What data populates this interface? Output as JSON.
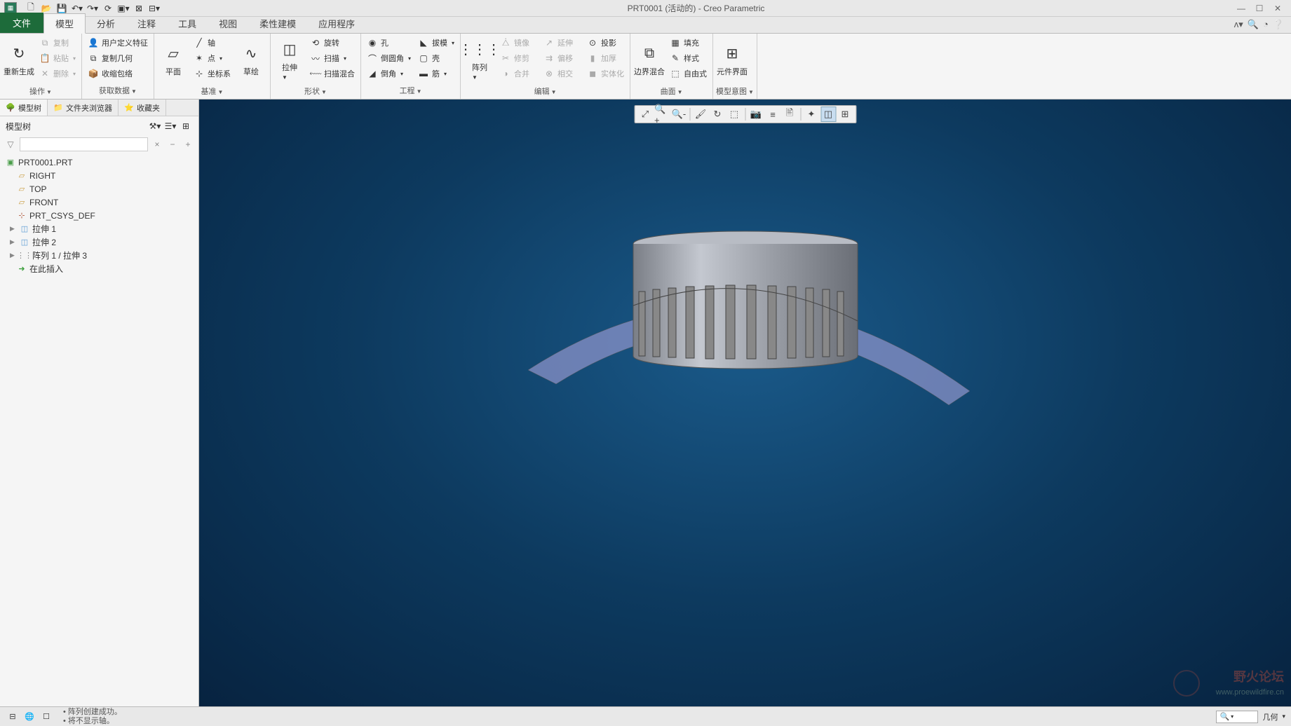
{
  "window": {
    "title": "PRT0001 (活动的) - Creo Parametric"
  },
  "qat": {
    "items": [
      "new",
      "open",
      "save",
      "undo",
      "redo",
      "regen",
      "windows",
      "close",
      "more"
    ]
  },
  "tabs": {
    "file": "文件",
    "list": [
      "模型",
      "分析",
      "注释",
      "工具",
      "视图",
      "柔性建模",
      "应用程序"
    ],
    "active": 0
  },
  "ribbon": {
    "groups": [
      {
        "label": "操作",
        "items": [
          {
            "big": "重新生成",
            "icon": "↻"
          },
          {
            "col": [
              {
                "t": "复制",
                "i": "⧉",
                "d": true
              },
              {
                "t": "粘贴",
                "i": "📋",
                "d": true,
                "dd": true
              },
              {
                "t": "删除",
                "i": "✕",
                "d": true,
                "dd": true
              }
            ]
          }
        ]
      },
      {
        "label": "获取数据",
        "items": [
          {
            "col": [
              {
                "t": "用户定义特征",
                "i": "👤"
              },
              {
                "t": "复制几何",
                "i": "⧉"
              },
              {
                "t": "收缩包络",
                "i": "📦"
              }
            ]
          }
        ]
      },
      {
        "label": "基准",
        "items": [
          {
            "big": "平面",
            "icon": "▱"
          },
          {
            "col": [
              {
                "t": "轴",
                "i": "╱"
              },
              {
                "t": "点",
                "i": "✶",
                "dd": true
              },
              {
                "t": "坐标系",
                "i": "⊹"
              }
            ]
          },
          {
            "big": "草绘",
            "icon": "∿"
          }
        ]
      },
      {
        "label": "形状",
        "items": [
          {
            "big": "拉伸",
            "icon": "◫",
            "dd": true
          },
          {
            "col": [
              {
                "t": "旋转",
                "i": "⟲"
              },
              {
                "t": "扫描",
                "i": "〰",
                "dd": true
              },
              {
                "t": "扫描混合",
                "i": "⬳"
              }
            ]
          }
        ]
      },
      {
        "label": "工程",
        "items": [
          {
            "col": [
              {
                "t": "孔",
                "i": "◉"
              },
              {
                "t": "倒圆角",
                "i": "⌒",
                "dd": true
              },
              {
                "t": "倒角",
                "i": "◢",
                "dd": true
              }
            ]
          },
          {
            "col": [
              {
                "t": "拔模",
                "i": "◣",
                "dd": true
              },
              {
                "t": "壳",
                "i": "▢"
              },
              {
                "t": "筋",
                "i": "▬",
                "dd": true
              }
            ]
          }
        ]
      },
      {
        "label": "编辑",
        "items": [
          {
            "big": "阵列",
            "icon": "⋮⋮⋮",
            "dd": true
          },
          {
            "col": [
              {
                "t": "镜像",
                "i": "⧊",
                "d": true
              },
              {
                "t": "修剪",
                "i": "✂",
                "d": true
              },
              {
                "t": "合并",
                "i": "◑",
                "d": true
              }
            ]
          },
          {
            "col": [
              {
                "t": "延伸",
                "i": "↗",
                "d": true
              },
              {
                "t": "偏移",
                "i": "⇉",
                "d": true
              },
              {
                "t": "相交",
                "i": "⊗",
                "d": true
              }
            ]
          },
          {
            "col": [
              {
                "t": "投影",
                "i": "⊙"
              },
              {
                "t": "加厚",
                "i": "▮",
                "d": true
              },
              {
                "t": "实体化",
                "i": "◼",
                "d": true
              }
            ]
          }
        ]
      },
      {
        "label": "曲面",
        "items": [
          {
            "big": "边界混合",
            "icon": "⧉"
          },
          {
            "col": [
              {
                "t": "填充",
                "i": "▦"
              },
              {
                "t": "样式",
                "i": "✎"
              },
              {
                "t": "自由式",
                "i": "⬚"
              }
            ]
          }
        ]
      },
      {
        "label": "模型意图",
        "items": [
          {
            "big": "元件界面",
            "icon": "⊞"
          }
        ]
      }
    ]
  },
  "sidepanel": {
    "tabs": [
      "模型树",
      "文件夹浏览器",
      "收藏夹"
    ],
    "tree_label": "模型树",
    "root": "PRT0001.PRT",
    "items": [
      {
        "t": "RIGHT",
        "cls": "datum",
        "i": "▱"
      },
      {
        "t": "TOP",
        "cls": "datum",
        "i": "▱"
      },
      {
        "t": "FRONT",
        "cls": "datum",
        "i": "▱"
      },
      {
        "t": "PRT_CSYS_DEF",
        "cls": "csys",
        "i": "⊹"
      },
      {
        "t": "拉伸 1",
        "cls": "feat",
        "i": "◫",
        "exp": true
      },
      {
        "t": "拉伸 2",
        "cls": "feat",
        "i": "◫",
        "exp": true
      },
      {
        "t": "阵列 1 / 拉伸 3",
        "cls": "pat",
        "i": "⋮⋮",
        "exp": true
      },
      {
        "t": "在此插入",
        "cls": "ins",
        "i": "➜"
      }
    ]
  },
  "viewtoolbar": {
    "items": [
      "refit",
      "zoom-in",
      "zoom-out",
      "repaint",
      "spin",
      "orient",
      "saved-views",
      "layers",
      "annotations",
      "render-style",
      "perspective",
      "wireframe",
      "shaded",
      "no-hidden"
    ]
  },
  "status": {
    "msg1": "阵列创建成功。",
    "msg2": "将不显示轴。",
    "find_label": "几何",
    "find_icon": "🔍"
  },
  "watermark": {
    "main": "野火论坛",
    "sub": "www.proewildfire.cn"
  }
}
